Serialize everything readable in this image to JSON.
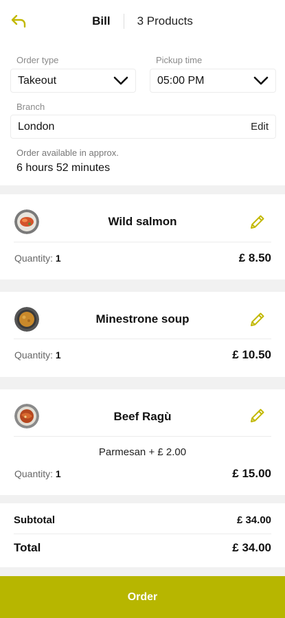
{
  "header": {
    "tab_bill": "Bill",
    "tab_products": "3 Products",
    "back_icon": "back-arrow-icon"
  },
  "order": {
    "order_type_label": "Order type",
    "order_type_value": "Takeout",
    "pickup_time_label": "Pickup time",
    "pickup_time_value": "05:00 PM",
    "branch_label": "Branch",
    "branch_value": "London",
    "branch_edit": "Edit",
    "available_label": "Order available in approx.",
    "available_value": "6 hours 52 minutes"
  },
  "products": [
    {
      "name": "Wild salmon",
      "quantity_label": "Quantity:",
      "quantity": "1",
      "price": "£ 8.50"
    },
    {
      "name": "Minestrone soup",
      "quantity_label": "Quantity:",
      "quantity": "1",
      "price": "£ 10.50"
    },
    {
      "name": "Beef Ragù",
      "quantity_label": "Quantity:",
      "quantity": "1",
      "price": "£ 15.00",
      "extra": "Parmesan + £ 2.00"
    }
  ],
  "totals": {
    "subtotal_label": "Subtotal",
    "subtotal_value": "£ 34.00",
    "total_label": "Total",
    "total_value": "£ 34.00"
  },
  "order_button": "Order",
  "colors": {
    "accent": "#b7b600",
    "background": "#f1f1f1"
  }
}
